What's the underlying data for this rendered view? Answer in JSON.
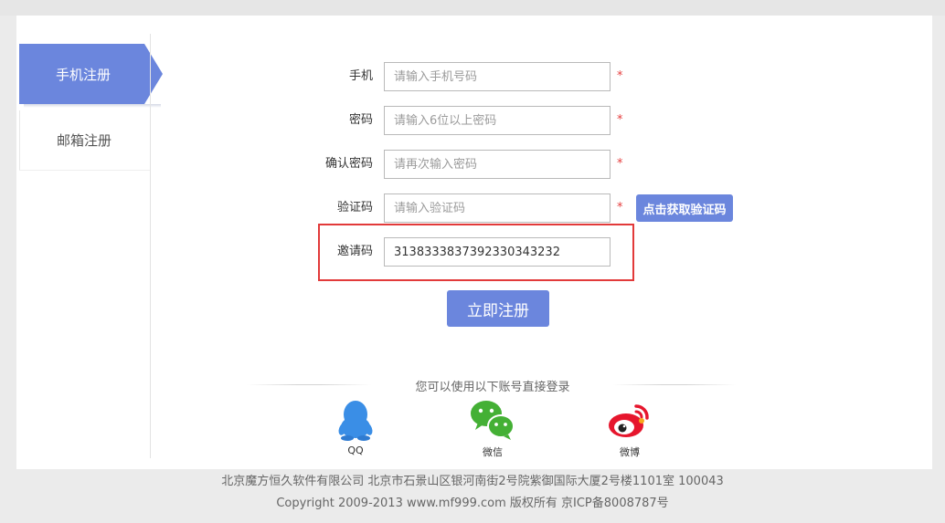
{
  "tabs": {
    "phone": "手机注册",
    "email": "邮箱注册"
  },
  "form": {
    "phone": {
      "label": "手机",
      "placeholder": "请输入手机号码",
      "required": "*"
    },
    "password": {
      "label": "密码",
      "placeholder": "请输入6位以上密码",
      "required": "*"
    },
    "confirm": {
      "label": "确认密码",
      "placeholder": "请再次输入密码",
      "required": "*"
    },
    "captcha": {
      "label": "验证码",
      "placeholder": "请输入验证码",
      "required": "*",
      "button": "点击获取验证码"
    },
    "invite": {
      "label": "邀请码",
      "value": "313833383739233034323​2"
    }
  },
  "submit_label": "立即注册",
  "social": {
    "title": "您可以使用以下账号直接登录",
    "items": [
      {
        "label": "QQ",
        "icon": "qq-icon"
      },
      {
        "label": "微信",
        "icon": "wechat-icon"
      },
      {
        "label": "微博",
        "icon": "weibo-icon"
      }
    ]
  },
  "footer": {
    "line1": "北京魔方恒久软件有限公司 北京市石景山区银河南街2号院紫御国际大厦2号楼1101室 100043",
    "line2": "Copyright 2009-2013 www.mf999.com 版权所有 京ICP备8008787号"
  },
  "colors": {
    "accent": "#6b86dd",
    "required": "#e53d3d",
    "highlight": "#e23a3a",
    "qq": "#3a8ee6",
    "wechat": "#44b035",
    "weibo": "#e6162d"
  }
}
